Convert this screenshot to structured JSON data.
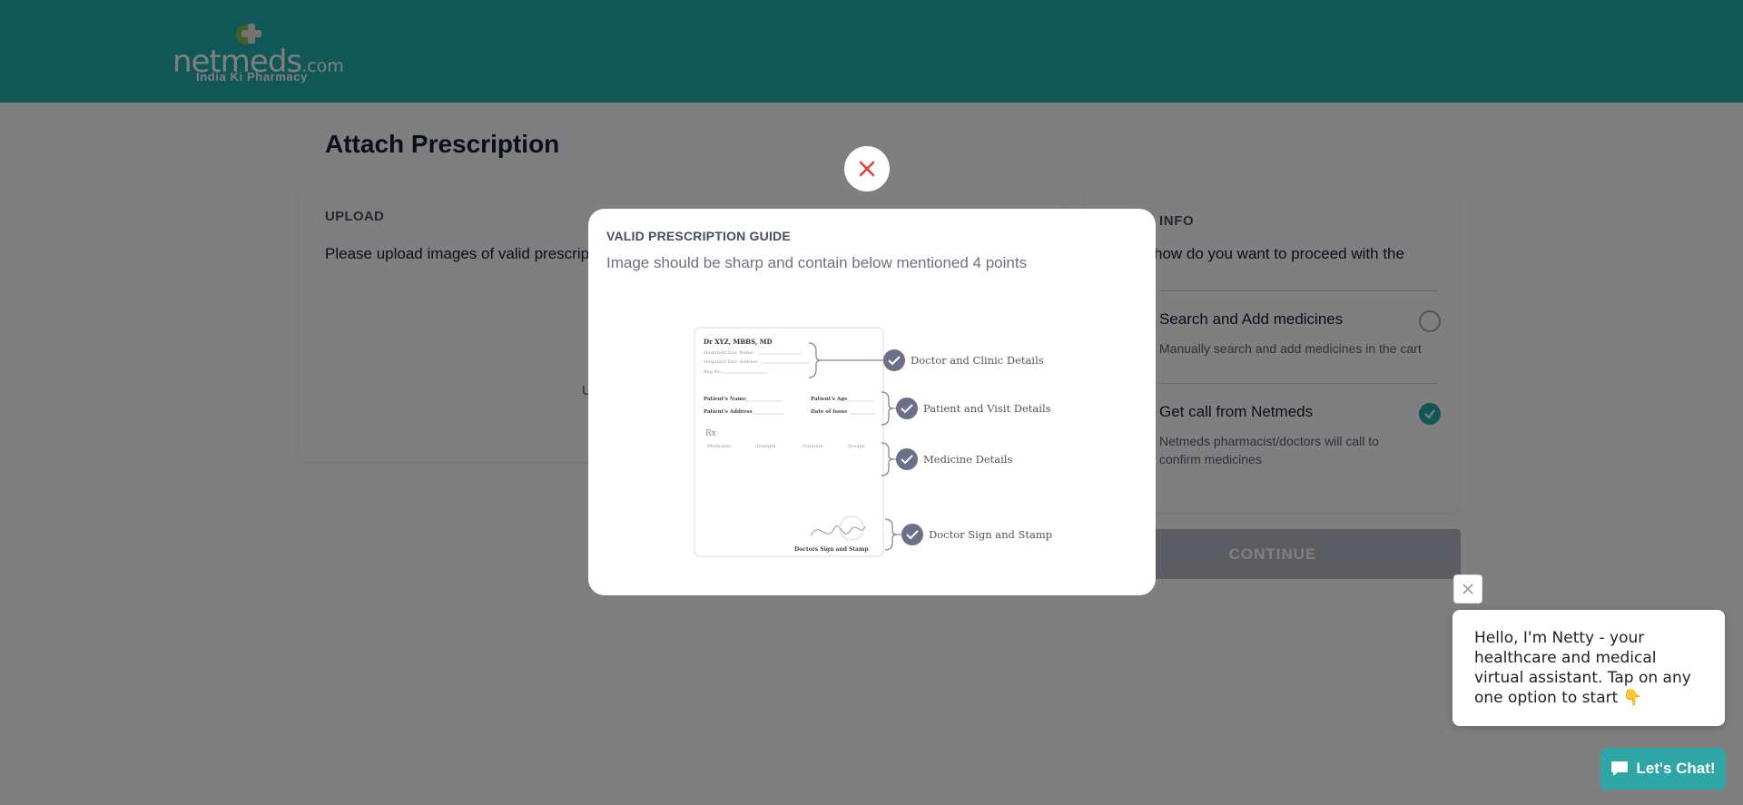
{
  "header": {
    "logo_text": "netmeds",
    "logo_suffix": ".com",
    "tagline": "India Ki Pharmacy"
  },
  "page": {
    "title": "Attach Prescription"
  },
  "upload": {
    "label": "UPLOAD",
    "text": "Please upload images of valid prescrip",
    "fragment": "U"
  },
  "info": {
    "label": "INFO",
    "question": "how do you want to proceed with the",
    "options": [
      {
        "title": "Search and Add medicines",
        "description": "Manually search and add medicines in the cart",
        "selected": false
      },
      {
        "title": "Get call from Netmeds",
        "description": "Netmeds pharmacist/doctors will call to confirm medicines",
        "selected": true
      }
    ]
  },
  "continue_label": "CONTINUE",
  "modal": {
    "title": "VALID PRESCRIPTION GUIDE",
    "subtitle": "Image should be sharp and contain below mentioned 4 points",
    "sample": {
      "doctor": "Dr XYZ, MBBS, MD",
      "hospital_name": "Hospital/Clinic Name",
      "hospital_address": "Hospital/Clinic Address",
      "reg_no": "Reg No.",
      "patient_name": "Patient's Name",
      "patient_age": "Patient's Age",
      "patient_address": "Patient's Address",
      "date_of_issue": "Date of Issue",
      "rx": "Rx",
      "cols": [
        "Medicines",
        "Strength",
        "Duration",
        "Dosage"
      ],
      "sign": "Doctors Sign and Stamp"
    },
    "points": [
      "Doctor and Clinic Details",
      "Patient and Visit Details",
      "Medicine Details",
      "Doctor Sign and Stamp"
    ]
  },
  "chat": {
    "message": "Hello, I'm Netty - your healthcare and medical virtual assistant. Tap on any one option to start 👇",
    "button": "Let's Chat!"
  },
  "colors": {
    "brand_teal": "#24aeb1",
    "text_dark": "#151b39",
    "close_red": "#e53935",
    "check_gray": "#6b7088"
  }
}
